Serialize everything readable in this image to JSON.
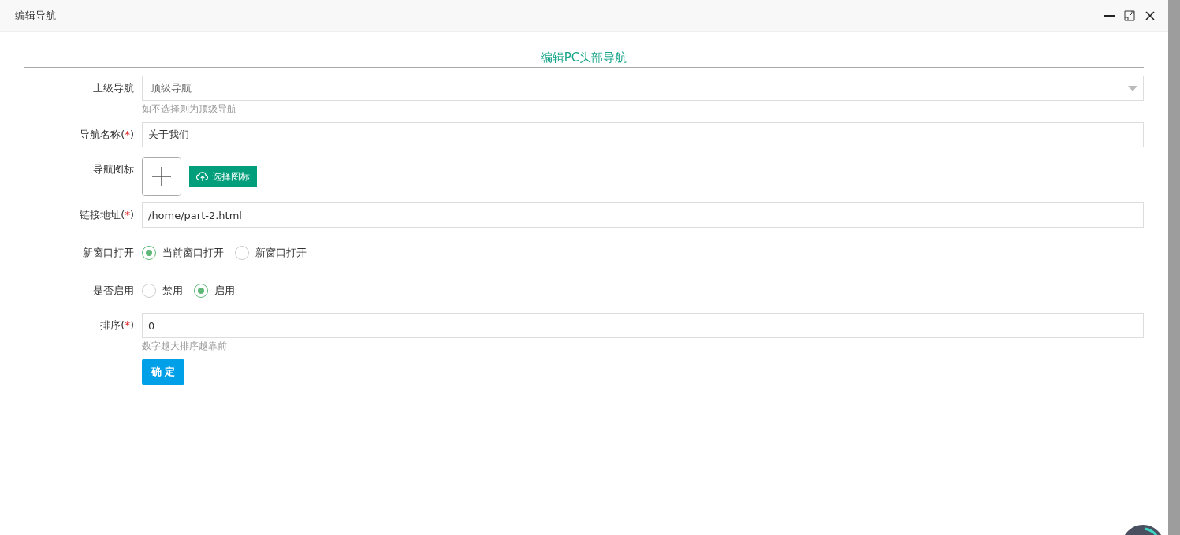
{
  "window": {
    "title": "编辑导航"
  },
  "form": {
    "heading": "编辑PC头部导航",
    "fields": [
      {
        "kind": "select",
        "label": "上级导航",
        "value": "顶级导航",
        "hint": "如不选择则为顶级导航"
      },
      {
        "kind": "text",
        "label": "导航名称",
        "required": [
          "(",
          "*",
          ")"
        ],
        "value": "关于我们"
      },
      {
        "kind": "icon",
        "label": "导航图标",
        "button": "选择图标"
      },
      {
        "kind": "text",
        "label": "链接地址",
        "required": [
          "(",
          "*",
          ")"
        ],
        "value": "/home/part-2.html"
      },
      {
        "kind": "radio",
        "label": "新窗口打开",
        "options": [
          {
            "label": "当前窗口打开",
            "selected": true
          },
          {
            "label": "新窗口打开",
            "selected": false
          }
        ]
      },
      {
        "kind": "radio",
        "label": "是否启用",
        "options": [
          {
            "label": "禁用",
            "selected": false
          },
          {
            "label": "启用",
            "selected": true
          }
        ]
      },
      {
        "kind": "text",
        "label": "排序",
        "required": [
          "(",
          "*",
          ")"
        ],
        "value": "0",
        "hint": "数字越大排序越靠前"
      }
    ],
    "submit": "确 定"
  }
}
